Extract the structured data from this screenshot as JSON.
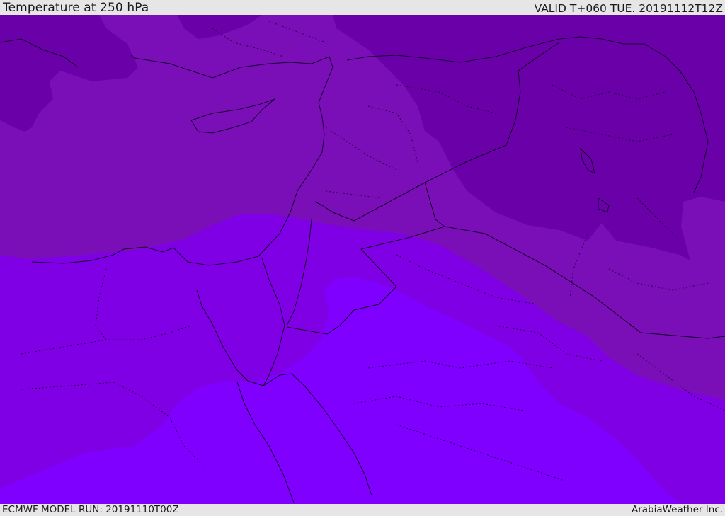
{
  "header": {
    "title": "Temperature at 250 hPa",
    "valid": "VALID T+060 TUE. 20191112T12Z"
  },
  "footer": {
    "model_run": "ECMWF MODEL RUN: 20191110T00Z",
    "credit": "ArabiaWeather Inc."
  },
  "map": {
    "field": "temperature-250hPa",
    "colors": {
      "darkest": "#6a01a8",
      "dark": "#7a0fb8",
      "mid": "#8000e6",
      "bright": "#7f00ff",
      "coastline": "#1a0030",
      "border": "#150025"
    }
  }
}
